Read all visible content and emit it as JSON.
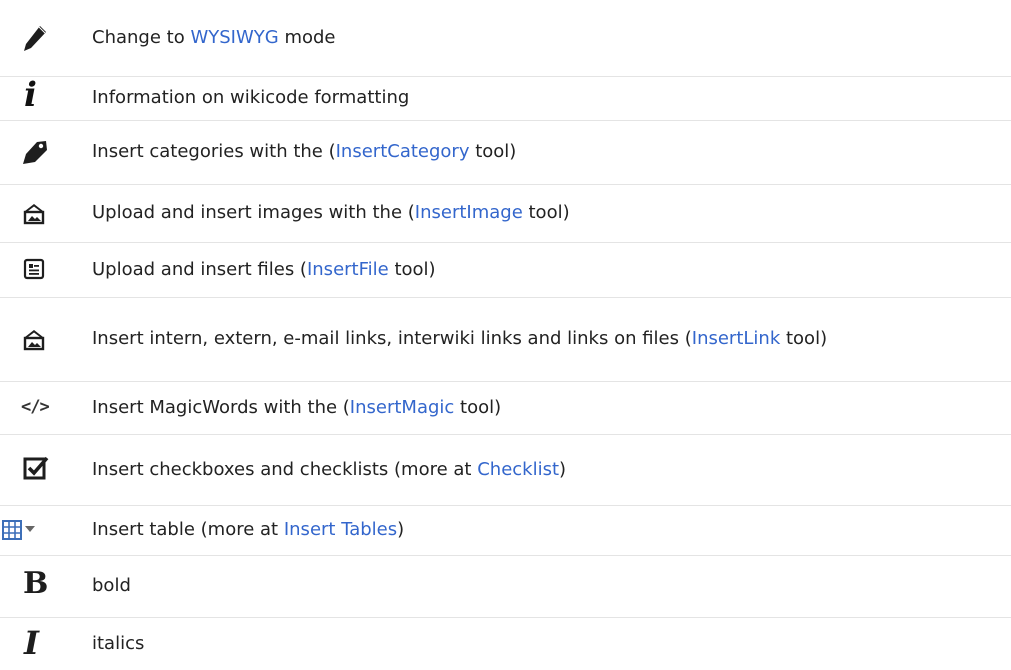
{
  "rows": [
    {
      "icon": "pencil-icon",
      "before": "Change to ",
      "link": "WYSIWYG",
      "after": " mode"
    },
    {
      "icon": "info-icon",
      "text": "Information on wikicode formatting"
    },
    {
      "icon": "tag-icon",
      "before": "Insert categories with the (",
      "link": "InsertCategory",
      "after": " tool)"
    },
    {
      "icon": "image-upload-icon",
      "before": "Upload and insert images with the (",
      "link": "InsertImage",
      "after": " tool)"
    },
    {
      "icon": "file-icon",
      "before": "Upload and insert files (",
      "link": "InsertFile",
      "after": " tool)"
    },
    {
      "icon": "link-icon",
      "before": "Insert intern, extern, e-mail links, interwiki links and links on files (",
      "link": "InsertLink",
      "after": " tool)"
    },
    {
      "icon": "code-icon",
      "before": "Insert MagicWords with the (",
      "link": "InsertMagic",
      "after": " tool)"
    },
    {
      "icon": "checkbox-icon",
      "before": "Insert checkboxes and checklists (more at ",
      "link": "Checklist",
      "after": ")"
    },
    {
      "icon": "table-icon",
      "before": "Insert table (more at ",
      "link": "Insert Tables",
      "after": ")"
    },
    {
      "icon": "bold-icon",
      "text": "bold",
      "glyph": "B"
    },
    {
      "icon": "italic-icon",
      "text": "italics",
      "glyph": "I"
    }
  ],
  "icons": {
    "info_glyph": "i",
    "code_glyph": "</>",
    "colors": {
      "link": "#3366cc",
      "text": "#222222",
      "icon": "#1e1e1e"
    }
  }
}
